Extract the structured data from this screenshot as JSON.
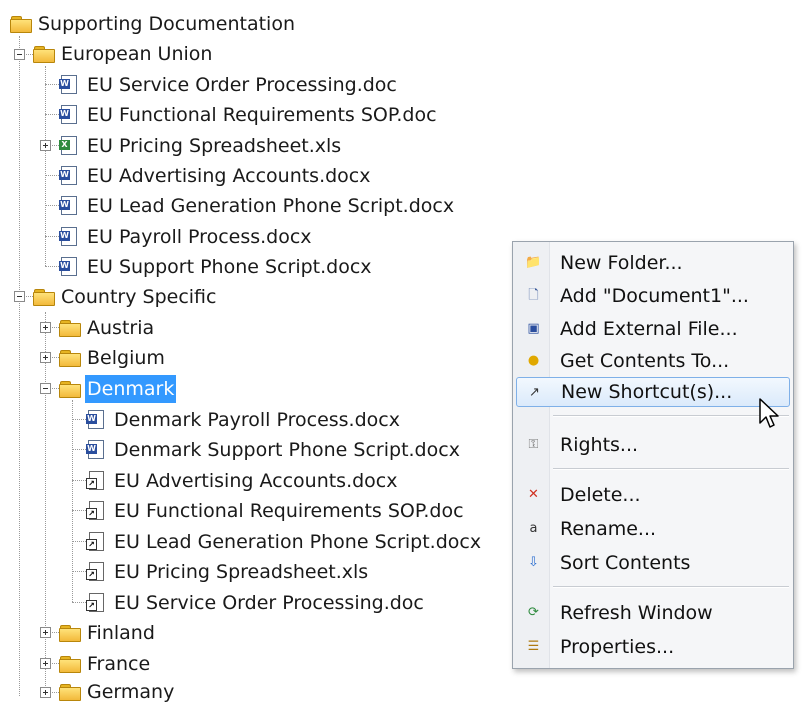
{
  "tree": {
    "root": "Supporting Documentation",
    "eu_folder": "European Union",
    "eu_items": [
      "EU Service Order Processing.doc",
      "EU Functional Requirements SOP.doc",
      "EU Pricing Spreadsheet.xls",
      "EU Advertising Accounts.docx",
      "EU Lead Generation Phone Script.docx",
      "EU Payroll Process.docx",
      "EU Support Phone Script.docx"
    ],
    "country_folder": "Country Specific",
    "countries_before": [
      "Austria",
      "Belgium"
    ],
    "selected_country": "Denmark",
    "denmark_items": [
      "Denmark Payroll Process.docx",
      "Denmark Support Phone Script.docx",
      "EU Advertising Accounts.docx",
      "EU Functional Requirements SOP.doc",
      "EU Lead Generation Phone Script.docx",
      "EU Pricing Spreadsheet.xls",
      "EU Service Order Processing.doc"
    ],
    "countries_after": [
      "Finland",
      "France",
      "Germany"
    ]
  },
  "context_menu": {
    "items": [
      {
        "label": "New Folder...",
        "icon": "new-folder-icon"
      },
      {
        "label": "Add \"Document1\"...",
        "icon": "add-document-icon"
      },
      {
        "label": "Add External File...",
        "icon": "add-external-file-icon"
      },
      {
        "label": "Get Contents To...",
        "icon": "get-contents-icon"
      },
      {
        "label": "New Shortcut(s)...",
        "icon": "new-shortcut-icon"
      },
      {
        "label": "Rights...",
        "icon": "rights-icon"
      },
      {
        "label": "Delete...",
        "icon": "delete-icon"
      },
      {
        "label": "Rename...",
        "icon": "rename-icon"
      },
      {
        "label": "Sort Contents",
        "icon": "sort-icon"
      },
      {
        "label": "Refresh Window",
        "icon": "refresh-icon"
      },
      {
        "label": "Properties...",
        "icon": "properties-icon"
      }
    ],
    "hovered_item": "New Shortcut(s)..."
  },
  "colors": {
    "selection": "#3399ff",
    "menu_hover_border": "#7fb0e8"
  }
}
